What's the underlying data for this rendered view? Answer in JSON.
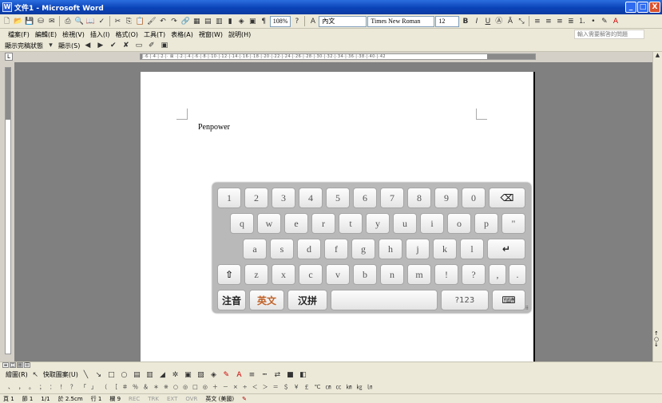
{
  "window": {
    "title": "文件1 - Microsoft Word",
    "buttons": {
      "minimize": "_",
      "maximize": "□",
      "close": "X"
    }
  },
  "standard_toolbar": {
    "zoom": "108%",
    "style": "內文",
    "font": "Times New Roman",
    "size": "12",
    "bold": "B",
    "italic": "I",
    "underline": "U"
  },
  "menu": {
    "items": [
      "檔案(F)",
      "編輯(E)",
      "檢視(V)",
      "插入(I)",
      "格式(O)",
      "工具(T)",
      "表格(A)",
      "視窗(W)",
      "說明(H)"
    ],
    "help_placeholder": "輸入需要解答的問題"
  },
  "reviewing_toolbar": {
    "display": "顯示完稿狀態",
    "show": "顯示(S)"
  },
  "ruler": {
    "ticks": "·|·6·|·4·|·2·|· ⊠ ·|·2·|·4·|·6·|·8·|·10·|·12·|·14·|·16·|·18·|·20·|·22·|·24·|·26·|·28·|·30·|·32·|·34·|·36·|·38·|·40·|·42"
  },
  "document": {
    "text": "Penpower"
  },
  "keyboard": {
    "row1": [
      "1",
      "2",
      "3",
      "4",
      "5",
      "6",
      "7",
      "8",
      "9",
      "0",
      "⌫"
    ],
    "row2": [
      "q",
      "w",
      "e",
      "r",
      "t",
      "y",
      "u",
      "i",
      "o",
      "p",
      "\""
    ],
    "row3": [
      "a",
      "s",
      "d",
      "f",
      "g",
      "h",
      "j",
      "k",
      "l",
      "↵"
    ],
    "row4": [
      "⇧",
      "z",
      "x",
      "c",
      "v",
      "b",
      "n",
      "m",
      "!",
      "?",
      ",",
      "."
    ],
    "row5": {
      "zhuyin": "注音",
      "english": "英文",
      "pinyin": "汉拼",
      "numbers": "?123",
      "hide": "⌨"
    },
    "active_mode_color": "#c0632a"
  },
  "drawing_toolbar": {
    "draw": "繪圖(R)",
    "autoshapes": "快取圖案(U)"
  },
  "symbol_toolbar": {
    "symbols": [
      "、",
      "，",
      "。",
      "；",
      "：",
      "！",
      "？",
      "「",
      "」",
      "（",
      "［",
      "＃",
      "％",
      "＆",
      "＊",
      "※",
      "○",
      "◎",
      "□",
      "◎",
      "＋",
      "－",
      "×",
      "÷",
      "＜",
      "＞",
      "＝",
      "＄",
      "￥",
      "￡",
      "℃",
      "㎝",
      "㏄",
      "㎞",
      "㎏",
      "㏑"
    ]
  },
  "statusbar": {
    "page": "頁 1",
    "section": "節 1",
    "page_of": "1/1",
    "at": "於 2.5cm",
    "line": "行 1",
    "col": "欄 9",
    "rec": "REC",
    "trk": "TRK",
    "ext": "EXT",
    "ovr": "OVR",
    "language": "英文 (美國)"
  }
}
